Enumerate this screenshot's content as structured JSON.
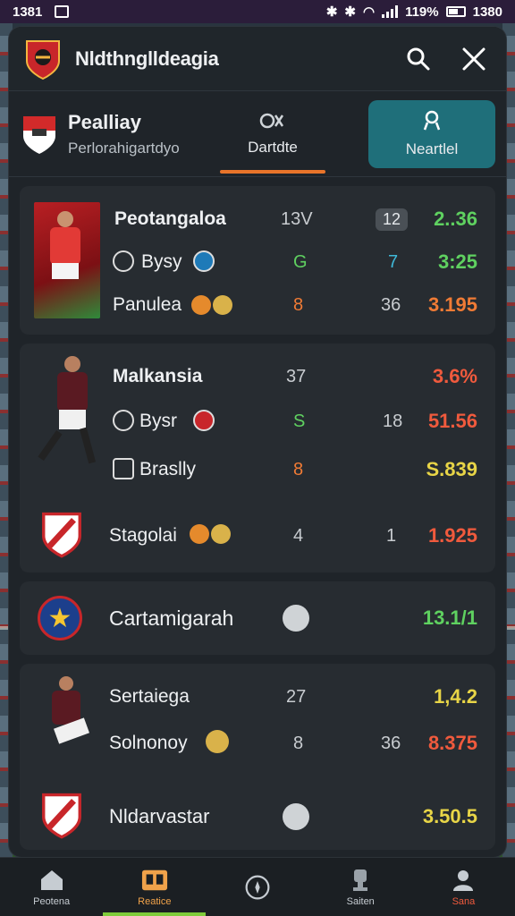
{
  "status_bar": {
    "time_left": "1381",
    "time_right": "1380",
    "battery": "119%"
  },
  "header": {
    "title": "Nldthnglldeagia"
  },
  "league": {
    "title": "Pealliay",
    "subtitle": "Perlorahigartdyo"
  },
  "tabs": [
    {
      "label": "Dartdte",
      "active": true
    },
    {
      "label": "Neartlel",
      "active": false
    }
  ],
  "cards": [
    {
      "rows": [
        {
          "name": "Peotangaloa",
          "c1": "13V",
          "c2": "12",
          "odds": "2..36",
          "odds_color": "green"
        },
        {
          "name": "Bysy",
          "c1": "G",
          "c2": "7",
          "odds": "3:25",
          "odds_color": "green"
        },
        {
          "name": "Panulea",
          "c1": "8",
          "c2": "36",
          "odds": "3.195",
          "odds_color": "orange"
        }
      ]
    },
    {
      "rows": [
        {
          "name": "Malkansia",
          "c1": "37",
          "c2": "",
          "odds": "3.6%",
          "odds_color": "red"
        },
        {
          "name": "Bysr",
          "c1": "S",
          "c2": "18",
          "odds": "51.56",
          "odds_color": "red"
        },
        {
          "name": "Braslly",
          "c1": "8",
          "c2": "",
          "odds": "S.839",
          "odds_color": "yellow"
        },
        {
          "name": "Stagolai",
          "c1": "4",
          "c2": "1",
          "odds": "1.925",
          "odds_color": "red"
        }
      ]
    },
    {
      "rows": [
        {
          "name": "Cartamigarah",
          "c1": "",
          "c2": "",
          "odds": "13.1/1",
          "odds_color": "green"
        }
      ]
    },
    {
      "rows": [
        {
          "name": "Sertaiega",
          "c1": "27",
          "c2": "",
          "odds": "1,4.2",
          "odds_color": "yellow"
        },
        {
          "name": "Solnonoy",
          "c1": "8",
          "c2": "36",
          "odds": "8.375",
          "odds_color": "red"
        },
        {
          "name": "Nldarvastar",
          "c1": "",
          "c2": "",
          "odds": "3.50.5",
          "odds_color": "yellow"
        }
      ]
    }
  ],
  "bottom_nav": [
    {
      "label": "Peotena",
      "icon": "home-icon",
      "active": false
    },
    {
      "label": "Reatice",
      "icon": "scoreboard-icon",
      "active": true
    },
    {
      "label": "",
      "icon": "compass-icon",
      "active": false
    },
    {
      "label": "Saiten",
      "icon": "trophy-icon",
      "active": false
    },
    {
      "label": "Sana",
      "icon": "profile-icon",
      "active": false
    }
  ],
  "colors": {
    "accent_orange": "#e8742a",
    "teal": "#1f6f7a",
    "green": "#5fd160",
    "red": "#f05a3d",
    "yellow": "#e8d547"
  }
}
